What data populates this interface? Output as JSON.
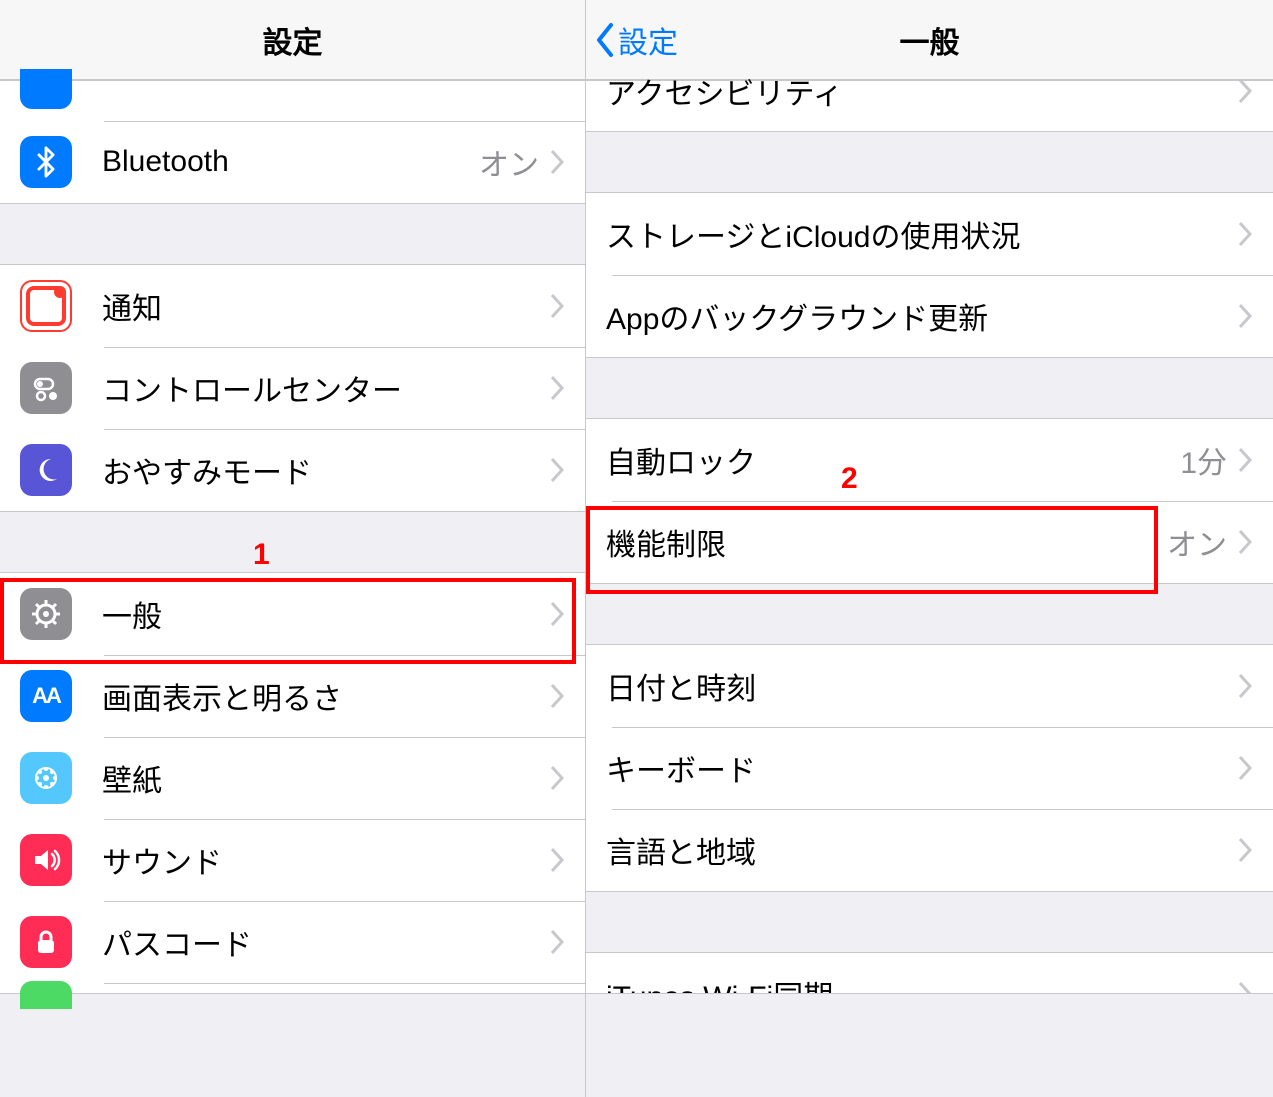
{
  "left": {
    "title": "設定",
    "row0": {
      "label": "",
      "value": ""
    },
    "bluetooth": {
      "label": "Bluetooth",
      "value": "オン"
    },
    "notifications": {
      "label": "通知"
    },
    "controlCenter": {
      "label": "コントロールセンター"
    },
    "dnd": {
      "label": "おやすみモード"
    },
    "general": {
      "label": "一般"
    },
    "display": {
      "label": "画面表示と明るさ"
    },
    "wallpaper": {
      "label": "壁紙"
    },
    "sounds": {
      "label": "サウンド"
    },
    "passcode": {
      "label": "パスコード"
    }
  },
  "right": {
    "backLabel": "設定",
    "title": "一般",
    "accessibility": {
      "label": "アクセシビリティ"
    },
    "storage": {
      "label": "ストレージとiCloudの使用状況"
    },
    "bgRefresh": {
      "label": "Appのバックグラウンド更新"
    },
    "autolock": {
      "label": "自動ロック",
      "value": "1分"
    },
    "restrictions": {
      "label": "機能制限",
      "value": "オン"
    },
    "datetime": {
      "label": "日付と時刻"
    },
    "keyboard": {
      "label": "キーボード"
    },
    "language": {
      "label": "言語と地域"
    },
    "itunes": {
      "label": "iTunes Wi-Fi同期"
    }
  },
  "annotations": {
    "left": "1",
    "right": "2"
  }
}
